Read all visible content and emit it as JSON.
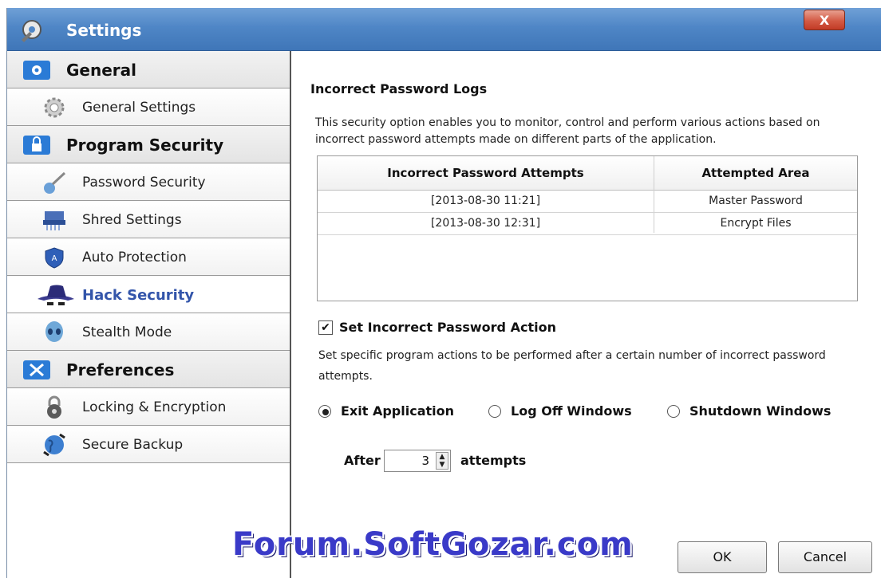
{
  "window": {
    "title": "Settings",
    "close_label": "X"
  },
  "sidebar": {
    "items": [
      {
        "label": "General",
        "type": "header",
        "icon": "gear-icon"
      },
      {
        "label": "General Settings",
        "type": "item",
        "icon": "gear-icon"
      },
      {
        "label": "Program Security",
        "type": "header",
        "icon": "lock-icon"
      },
      {
        "label": "Password Security",
        "type": "item",
        "icon": "key-icon"
      },
      {
        "label": "Shred Settings",
        "type": "item",
        "icon": "shredder-icon"
      },
      {
        "label": "Auto Protection",
        "type": "item",
        "icon": "shield-icon"
      },
      {
        "label": "Hack Security",
        "type": "item",
        "icon": "spy-hat-icon",
        "selected": true
      },
      {
        "label": "Stealth Mode",
        "type": "item",
        "icon": "alien-icon"
      },
      {
        "label": "Preferences",
        "type": "header",
        "icon": "tools-icon"
      },
      {
        "label": "Locking & Encryption",
        "type": "item",
        "icon": "padlock-icon"
      },
      {
        "label": "Secure Backup",
        "type": "item",
        "icon": "globe-icon"
      }
    ]
  },
  "main": {
    "title": "Incorrect Password Logs",
    "description": "This security option enables you to monitor, control and perform various actions based on incorrect password attempts made on different parts of the application.",
    "table": {
      "columns": [
        "Incorrect Password Attempts",
        "Attempted Area"
      ],
      "rows": [
        [
          "[2013-08-30 11:21]",
          "Master Password"
        ],
        [
          "[2013-08-30 12:31]",
          "Encrypt Files"
        ]
      ]
    },
    "action_checkbox": {
      "label": "Set Incorrect Password Action",
      "checked": true,
      "glyph": "✔"
    },
    "action_description": "Set specific program actions to be performed after a certain number of incorrect password attempts.",
    "radios": [
      {
        "label": "Exit Application",
        "selected": true
      },
      {
        "label": "Log Off Windows",
        "selected": false
      },
      {
        "label": "Shutdown Windows",
        "selected": false
      }
    ],
    "after": {
      "label": "After",
      "value": "3",
      "suffix": "attempts"
    }
  },
  "footer": {
    "ok_label": "OK",
    "cancel_label": "Cancel",
    "watermark": "Forum.SoftGozar.com"
  }
}
